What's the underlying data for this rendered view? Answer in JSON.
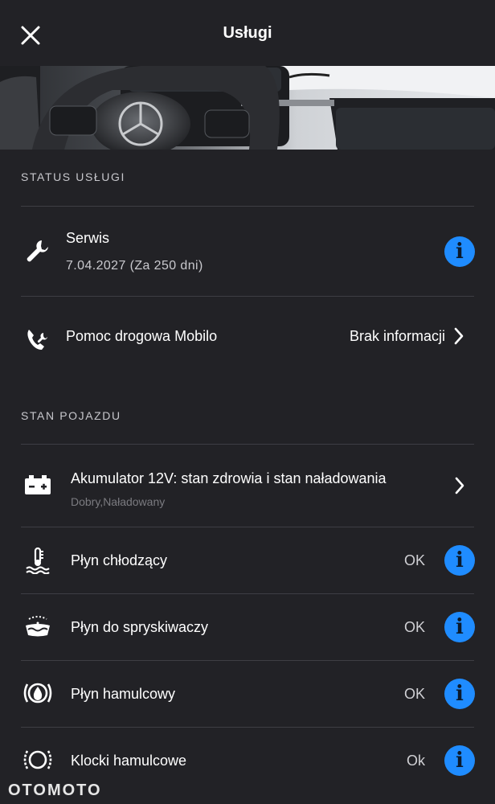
{
  "header": {
    "title": "Usługi"
  },
  "service_status": {
    "section_label": "STATUS USŁUGI",
    "service": {
      "title": "Serwis",
      "date": "7.04.2027 (Za 250 dni)",
      "icon": "wrench-icon"
    },
    "roadside": {
      "title": "Pomoc drogowa Mobilo",
      "value": "Brak informacji",
      "icon": "phone-wrench-icon"
    }
  },
  "vehicle_status": {
    "section_label": "STAN POJAZDU",
    "battery": {
      "title": "Akumulator 12V: stan zdrowia i stan naładowania",
      "subtitle": "Dobry,Naładowany",
      "icon": "battery-icon"
    },
    "items": [
      {
        "title": "Płyn chłodzący",
        "status": "OK",
        "icon": "coolant-icon"
      },
      {
        "title": "Płyn do spryskiwaczy",
        "status": "OK",
        "icon": "washer-fluid-icon"
      },
      {
        "title": "Płyn hamulcowy",
        "status": "OK",
        "icon": "brake-fluid-icon"
      },
      {
        "title": "Klocki hamulcowe",
        "status": "Ok",
        "icon": "brake-pads-icon"
      }
    ]
  },
  "watermark": {
    "text": "OTOMOTO"
  },
  "colors": {
    "background": "#222226",
    "accent": "#1f8cff",
    "divider": "#3e3e44"
  }
}
